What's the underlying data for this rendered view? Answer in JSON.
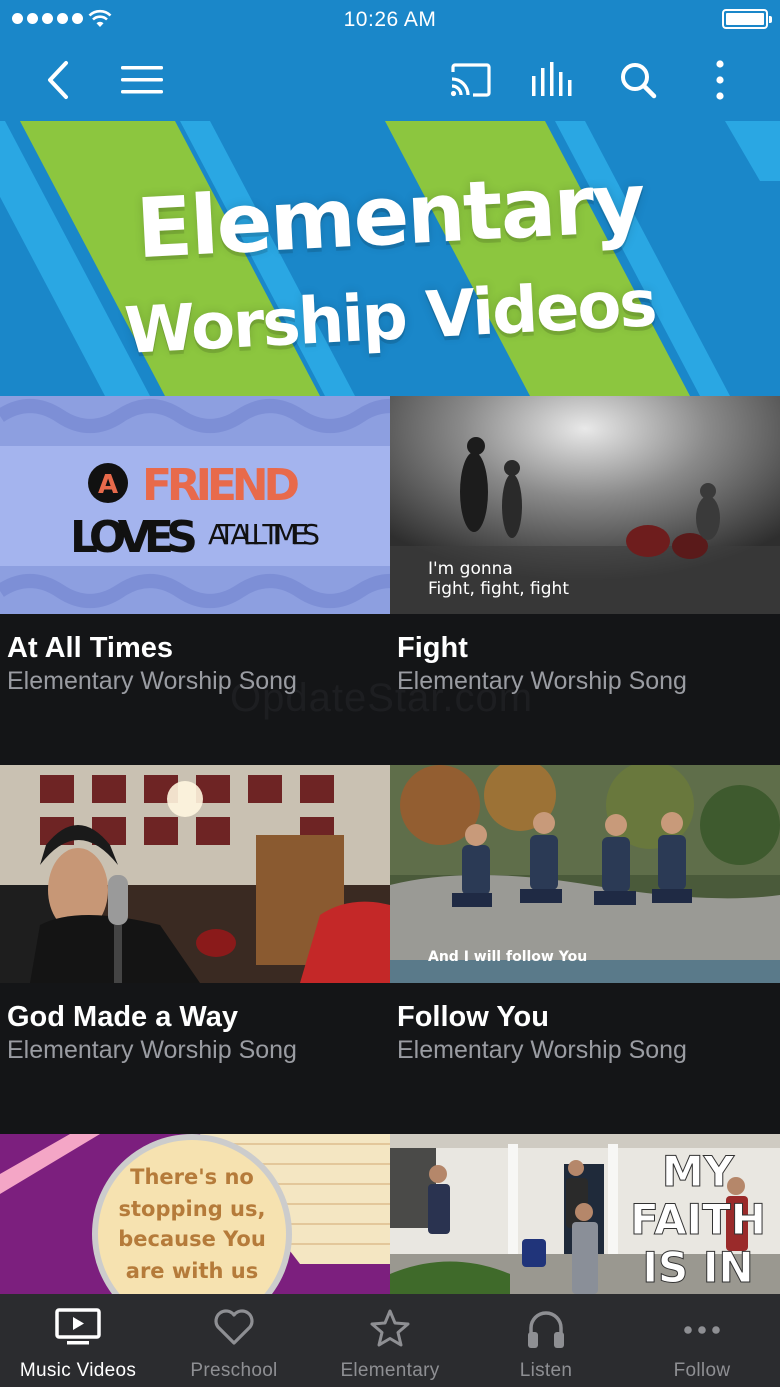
{
  "status_bar": {
    "time": "10:26 AM"
  },
  "app_bar": {
    "icons": [
      "back-icon",
      "menu-icon",
      "cast-icon",
      "equalizer-icon",
      "search-icon",
      "more-vertical-icon"
    ]
  },
  "banner": {
    "line1": "Elementary",
    "line2": "Worship Videos"
  },
  "videos": [
    {
      "title": "At All Times",
      "subtitle": "Elementary Worship Song",
      "thumb_text": {
        "circle": "A",
        "word1": "FRIEND",
        "word2": "LOVES",
        "word3": "AT ALL TIMES"
      }
    },
    {
      "title": "Fight",
      "subtitle": "Elementary Worship Song",
      "thumb_text": {
        "line1": "I'm gonna",
        "line2": "Fight, fight, fight"
      }
    },
    {
      "title": "God Made a Way",
      "subtitle": "Elementary Worship Song"
    },
    {
      "title": "Follow You",
      "subtitle": "Elementary Worship Song",
      "thumb_text": {
        "caption": "And I will follow You"
      }
    },
    {
      "title": "",
      "subtitle": "",
      "thumb_text": {
        "line1": "There's no",
        "line2": "stopping us,",
        "line3": "because You",
        "line4": "are with us"
      }
    },
    {
      "title": "",
      "subtitle": "",
      "thumb_text": {
        "line1": "MY",
        "line2": "FAITH",
        "line3": "IS IN"
      }
    }
  ],
  "watermark": "OpdateStar.com",
  "tabs": [
    {
      "label": "Music Videos",
      "icon": "tv-play-icon",
      "active": true
    },
    {
      "label": "Preschool",
      "icon": "heart-icon",
      "active": false
    },
    {
      "label": "Elementary",
      "icon": "star-icon",
      "active": false
    },
    {
      "label": "Listen",
      "icon": "headphones-icon",
      "active": false
    },
    {
      "label": "Follow",
      "icon": "more-horizontal-icon",
      "active": false
    }
  ],
  "colors": {
    "primary": "#1a87c9",
    "banner_green": "#8cc63f",
    "background": "#141517",
    "tab_bar": "#2b2c2f"
  }
}
